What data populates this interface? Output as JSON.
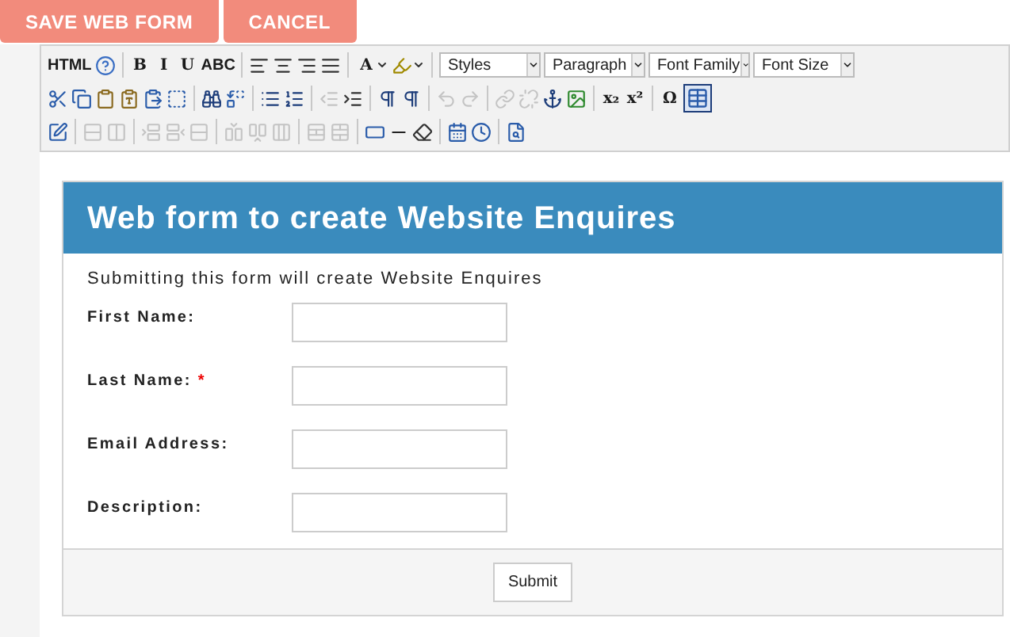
{
  "actions": [
    {
      "label": "SAVE WEB FORM"
    },
    {
      "label": "CANCEL"
    }
  ],
  "toolbar": [
    [
      {
        "kind": "text",
        "text": "HTML",
        "disabled": false
      },
      {
        "kind": "icon",
        "disabled": false
      },
      {
        "kind": "sep"
      },
      {
        "kind": "text",
        "text": "B",
        "disabled": false
      },
      {
        "kind": "text",
        "text": "I",
        "disabled": false
      },
      {
        "kind": "text",
        "text": "U",
        "disabled": false
      },
      {
        "kind": "text",
        "text": "ABC",
        "disabled": false
      },
      {
        "kind": "sep"
      },
      {
        "kind": "icon",
        "disabled": false
      },
      {
        "kind": "icon",
        "disabled": false
      },
      {
        "kind": "icon",
        "disabled": false
      },
      {
        "kind": "icon",
        "disabled": false
      },
      {
        "kind": "sep"
      },
      {
        "kind": "text",
        "text": "A",
        "disabled": false
      },
      {
        "kind": "caret"
      },
      {
        "kind": "icon",
        "disabled": false
      },
      {
        "kind": "caret"
      },
      {
        "kind": "sep"
      },
      {
        "kind": "select",
        "text": "Styles"
      },
      {
        "kind": "select",
        "text": "Paragraph"
      },
      {
        "kind": "select",
        "text": "Font Family"
      },
      {
        "kind": "select",
        "text": "Font Size"
      }
    ],
    [
      {
        "kind": "icon",
        "disabled": false
      },
      {
        "kind": "icon",
        "disabled": false
      },
      {
        "kind": "icon",
        "disabled": false
      },
      {
        "kind": "icon",
        "disabled": false
      },
      {
        "kind": "icon",
        "disabled": false
      },
      {
        "kind": "icon",
        "disabled": false
      },
      {
        "kind": "sep"
      },
      {
        "kind": "icon",
        "disabled": false
      },
      {
        "kind": "icon",
        "disabled": false
      },
      {
        "kind": "sep"
      },
      {
        "kind": "icon",
        "disabled": false
      },
      {
        "kind": "icon",
        "disabled": false
      },
      {
        "kind": "sep"
      },
      {
        "kind": "icon",
        "disabled": true
      },
      {
        "kind": "icon",
        "disabled": false
      },
      {
        "kind": "sep"
      },
      {
        "kind": "icon",
        "disabled": false
      },
      {
        "kind": "icon",
        "disabled": false
      },
      {
        "kind": "sep"
      },
      {
        "kind": "icon",
        "disabled": true
      },
      {
        "kind": "icon",
        "disabled": true
      },
      {
        "kind": "sep"
      },
      {
        "kind": "icon",
        "disabled": true
      },
      {
        "kind": "icon",
        "disabled": true
      },
      {
        "kind": "icon",
        "disabled": false
      },
      {
        "kind": "icon",
        "disabled": false
      },
      {
        "kind": "sep"
      },
      {
        "kind": "text",
        "text": "x₂",
        "disabled": false
      },
      {
        "kind": "text",
        "text": "x²",
        "disabled": false
      },
      {
        "kind": "sep"
      },
      {
        "kind": "text",
        "text": "Ω",
        "disabled": false
      },
      {
        "kind": "icon",
        "disabled": false
      }
    ],
    [
      {
        "kind": "icon",
        "disabled": false
      },
      {
        "kind": "sep"
      },
      {
        "kind": "icon",
        "disabled": true
      },
      {
        "kind": "icon",
        "disabled": true
      },
      {
        "kind": "sep"
      },
      {
        "kind": "icon",
        "disabled": true
      },
      {
        "kind": "icon",
        "disabled": true
      },
      {
        "kind": "icon",
        "disabled": true
      },
      {
        "kind": "sep"
      },
      {
        "kind": "icon",
        "disabled": true
      },
      {
        "kind": "icon",
        "disabled": true
      },
      {
        "kind": "icon",
        "disabled": true
      },
      {
        "kind": "sep"
      },
      {
        "kind": "icon",
        "disabled": true
      },
      {
        "kind": "icon",
        "disabled": true
      },
      {
        "kind": "sep"
      },
      {
        "kind": "icon",
        "disabled": false
      },
      {
        "kind": "icon",
        "disabled": false
      },
      {
        "kind": "icon",
        "disabled": false
      },
      {
        "kind": "sep"
      },
      {
        "kind": "icon",
        "disabled": false
      },
      {
        "kind": "icon",
        "disabled": false
      },
      {
        "kind": "sep"
      },
      {
        "kind": "icon",
        "disabled": false
      }
    ]
  ],
  "form": {
    "title": "Web form to create Website Enquires",
    "intro": "Submitting this form will create Website Enquires",
    "fields": [
      {
        "label": "First Name:"
      },
      {
        "label": "Last Name:",
        "required_mark": "*"
      },
      {
        "label": "Email Address:"
      },
      {
        "label": "Description:"
      }
    ],
    "submit": "Submit"
  }
}
